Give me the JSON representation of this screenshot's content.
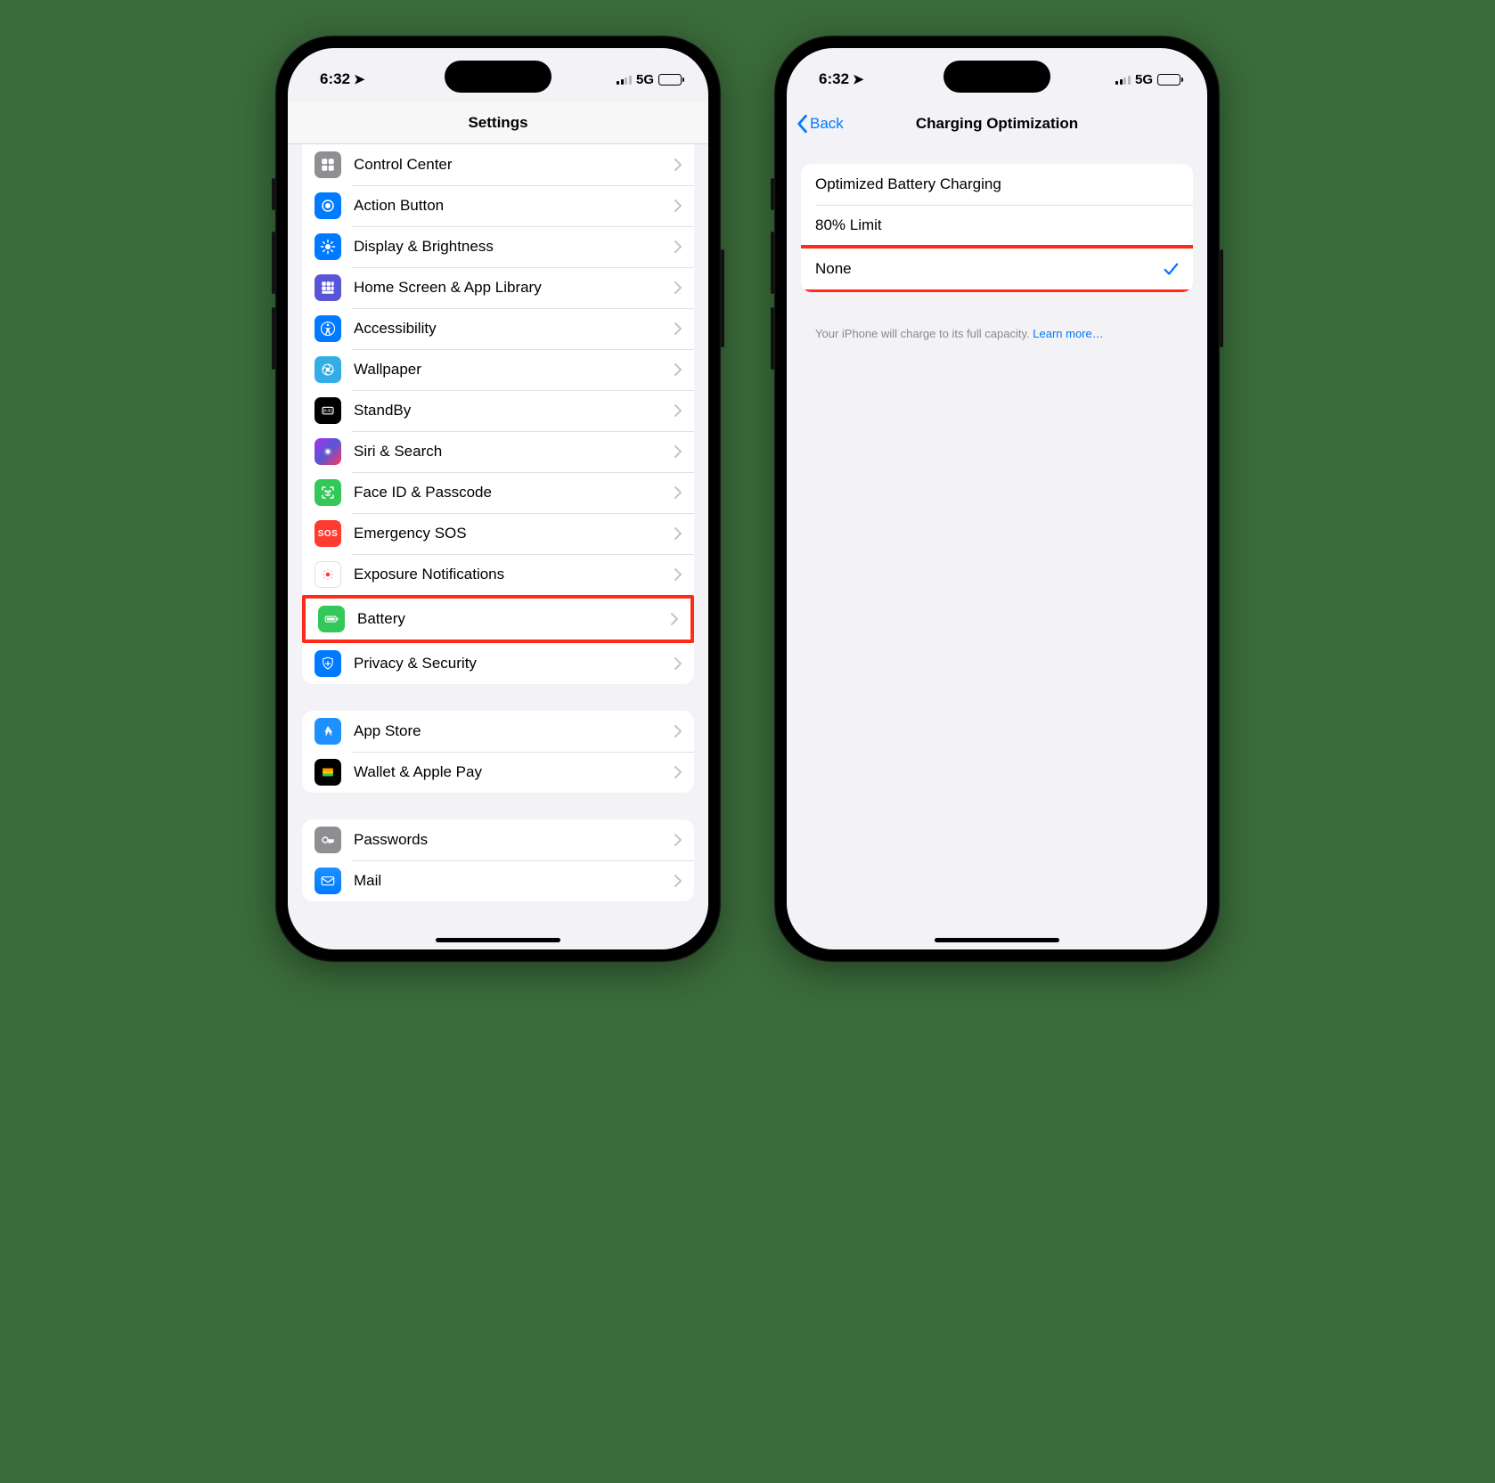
{
  "status": {
    "time": "6:32",
    "network": "5G"
  },
  "left": {
    "title": "Settings",
    "group1": [
      {
        "label": "Control Center",
        "icon": "control-center-icon",
        "bg": "bg-gray"
      },
      {
        "label": "Action Button",
        "icon": "action-button-icon",
        "bg": "bg-blue"
      },
      {
        "label": "Display & Brightness",
        "icon": "brightness-icon",
        "bg": "bg-blue"
      },
      {
        "label": "Home Screen & App Library",
        "icon": "home-screen-icon",
        "bg": "bg-indigo"
      },
      {
        "label": "Accessibility",
        "icon": "accessibility-icon",
        "bg": "bg-blue"
      },
      {
        "label": "Wallpaper",
        "icon": "wallpaper-icon",
        "bg": "bg-teal"
      },
      {
        "label": "StandBy",
        "icon": "standby-icon",
        "bg": "bg-black"
      },
      {
        "label": "Siri & Search",
        "icon": "siri-icon",
        "bg": "bg-purple"
      },
      {
        "label": "Face ID & Passcode",
        "icon": "faceid-icon",
        "bg": "bg-green"
      },
      {
        "label": "Emergency SOS",
        "icon": "sos-icon",
        "bg": "bg-red",
        "text": "SOS"
      },
      {
        "label": "Exposure Notifications",
        "icon": "exposure-icon",
        "bg": "bg-white"
      },
      {
        "label": "Battery",
        "icon": "battery-icon",
        "bg": "bg-green",
        "highlight": true
      },
      {
        "label": "Privacy & Security",
        "icon": "privacy-icon",
        "bg": "bg-blue"
      }
    ],
    "group2": [
      {
        "label": "App Store",
        "icon": "appstore-icon",
        "bg": "bg-store"
      },
      {
        "label": "Wallet & Apple Pay",
        "icon": "wallet-icon",
        "bg": "bg-wallet"
      }
    ],
    "group3": [
      {
        "label": "Passwords",
        "icon": "passwords-icon",
        "bg": "bg-gray"
      },
      {
        "label": "Mail",
        "icon": "mail-icon",
        "bg": "bg-mail"
      }
    ]
  },
  "right": {
    "back": "Back",
    "title": "Charging Optimization",
    "options": [
      {
        "label": "Optimized Battery Charging",
        "selected": false
      },
      {
        "label": "80% Limit",
        "selected": false
      },
      {
        "label": "None",
        "selected": true,
        "highlight": true
      }
    ],
    "footer": "Your iPhone will charge to its full capacity.",
    "learn": "Learn more…"
  }
}
